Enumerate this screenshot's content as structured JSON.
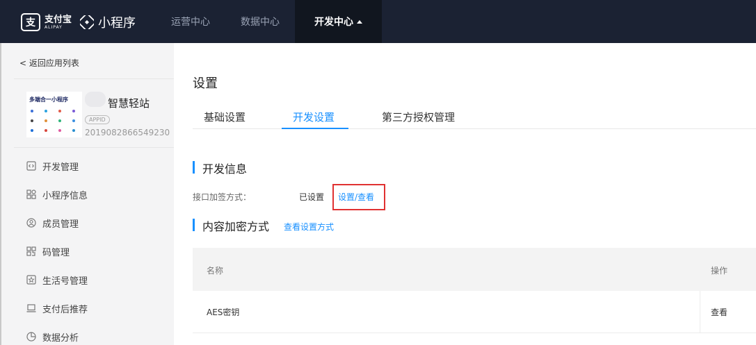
{
  "header": {
    "alipay_cn": "支付宝",
    "alipay_en": "ALIPAY",
    "product": "小程序",
    "nav": [
      "运营中心",
      "数据中心",
      "开发中心"
    ]
  },
  "sidebar": {
    "back": "返回应用列表",
    "app": {
      "thumb_title": "多端合一小程序",
      "name": "智慧轻站",
      "badge": "APPID",
      "id": "2019082866549230"
    },
    "menu": [
      "开发管理",
      "小程序信息",
      "成员管理",
      "码管理",
      "生活号管理",
      "支付后推荐",
      "数据分析"
    ]
  },
  "main": {
    "title": "设置",
    "tabs": [
      "基础设置",
      "开发设置",
      "第三方授权管理"
    ],
    "dev_info": {
      "title": "开发信息",
      "label": "接口加签方式：",
      "value": "已设置",
      "link": "设置/查看"
    },
    "encrypt": {
      "title": "内容加密方式",
      "link": "查看设置方式"
    },
    "table": {
      "headers": [
        "名称",
        "操作"
      ],
      "rows": [
        {
          "name": "AES密钥",
          "action": "查看"
        }
      ]
    }
  },
  "colors": {
    "accent": "#1890ff",
    "topbar": "#1b2233",
    "highlight": "#e03131"
  }
}
